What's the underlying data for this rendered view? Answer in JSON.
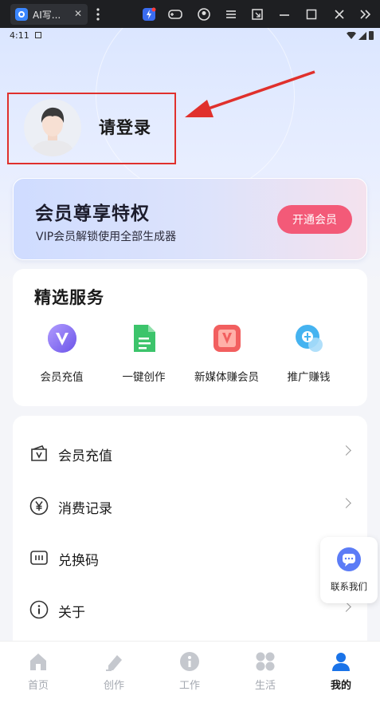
{
  "emulator": {
    "tab_title": "AI写...",
    "tab_close": "✕",
    "icons": [
      "bolt-icon",
      "gamepad-icon",
      "user-circle-icon",
      "menu-icon",
      "window-icon",
      "minimize-icon",
      "maximize-icon",
      "close-icon",
      "expand-icon"
    ]
  },
  "status_bar": {
    "time": "4:11"
  },
  "login": {
    "text": "请登录"
  },
  "vip": {
    "title": "会员尊享特权",
    "subtitle": "VIP会员解锁使用全部生成器",
    "button": "开通会员"
  },
  "services": {
    "title": "精选服务",
    "items": [
      {
        "label": "会员充值",
        "icon": "vip-v-icon",
        "color": "#7c6cf0"
      },
      {
        "label": "一键创作",
        "icon": "document-icon",
        "color": "#3cc46b"
      },
      {
        "label": "新媒体赚会员",
        "icon": "media-v-icon",
        "color": "#f06060"
      },
      {
        "label": "推广赚钱",
        "icon": "promote-icon",
        "color": "#44b0ee"
      }
    ]
  },
  "menu": {
    "items": [
      {
        "label": "会员充值",
        "icon": "wallet-icon"
      },
      {
        "label": "消费记录",
        "icon": "yen-icon"
      },
      {
        "label": "兑换码",
        "icon": "code-icon"
      },
      {
        "label": "关于",
        "icon": "info-icon"
      }
    ]
  },
  "contact": {
    "label": "联系我们"
  },
  "tabbar": {
    "items": [
      {
        "label": "首页",
        "icon": "home-icon"
      },
      {
        "label": "创作",
        "icon": "pen-icon"
      },
      {
        "label": "工作",
        "icon": "work-icon"
      },
      {
        "label": "生活",
        "icon": "grid-icon"
      },
      {
        "label": "我的",
        "icon": "profile-icon"
      }
    ],
    "active": "我的"
  },
  "colors": {
    "accent": "#f35a78",
    "annotation": "#e0302c",
    "tab_active": "#1a73e8"
  }
}
